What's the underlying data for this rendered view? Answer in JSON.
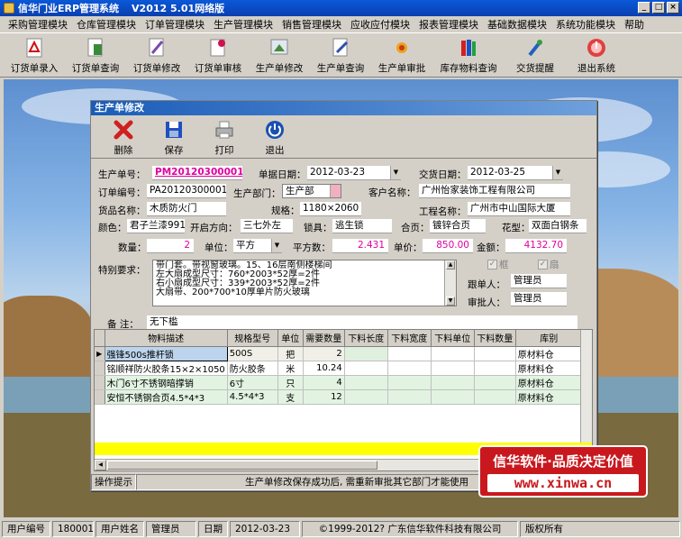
{
  "app": {
    "title": "信华门业ERP管理系统",
    "version": "V2012  5.01网络版"
  },
  "menu": [
    "采购管理模块",
    "仓库管理模块",
    "订单管理模块",
    "生产管理模块",
    "销售管理模块",
    "应收应付模块",
    "报表管理模块",
    "基础数据模块",
    "系统功能模块",
    "帮助"
  ],
  "toolbar": [
    {
      "label": "订货单录入",
      "icon": "pdf-document-icon"
    },
    {
      "label": "订货单查询",
      "icon": "document-search-icon"
    },
    {
      "label": "订货单修改",
      "icon": "document-edit-icon"
    },
    {
      "label": "订货单审核",
      "icon": "document-pin-icon"
    },
    {
      "label": "生产单修改",
      "icon": "image-edit-icon"
    },
    {
      "label": "生产单查询",
      "icon": "document-pencil-icon"
    },
    {
      "label": "生产单审批",
      "icon": "flower-icon"
    },
    {
      "label": "库存物料查询",
      "icon": "books-icon"
    },
    {
      "label": "交货提醒",
      "icon": "pen-icon"
    },
    {
      "label": "退出系统",
      "icon": "exit-icon"
    }
  ],
  "window": {
    "title": "生产单修改",
    "tools": [
      {
        "label": "删除",
        "icon": "delete-x-icon"
      },
      {
        "label": "保存",
        "icon": "save-disk-icon"
      },
      {
        "label": "打印",
        "icon": "printer-icon"
      },
      {
        "label": "退出",
        "icon": "power-icon"
      }
    ]
  },
  "form": {
    "prod_no_label": "生产单号：",
    "prod_no": "PM20120300001",
    "bill_date_label": "单据日期：",
    "bill_date": "2012-03-23",
    "delivery_date_label": "交货日期：",
    "delivery_date": "2012-03-25",
    "order_no_label": "订单编号：",
    "order_no": "PA20120300001",
    "dept_label": "生产部门：",
    "dept": "生产部",
    "customer_label": "客户名称：",
    "customer": "广州怡家装饰工程有限公司",
    "goods_label": "货品名称：",
    "goods": "木质防火门",
    "spec_label": "规格：",
    "spec": "1180×2060",
    "project_label": "工程名称：",
    "project": "广州市中山国际大厦",
    "color_label": "颜色：",
    "color": "君子兰漆9913",
    "open_dir_label": "开启方向：",
    "open_dir": "三七外左",
    "lock_label": "锁具：",
    "lock": "逃生锁",
    "hinge_label": "合页：",
    "hinge": "镀锌合页",
    "pattern_label": "花型：",
    "pattern": "双面白钢条",
    "qty_label": "数量：",
    "qty": "2",
    "unit_label": "单位：",
    "unit": "平方",
    "area_label": "平方数：",
    "area": "2.431",
    "price_label": "单价：",
    "price": "850.00",
    "amount_label": "金额：",
    "amount": "4132.70",
    "special_label": "特别要求：",
    "special_lines": [
      "带门套。带视窗玻璃。15、16层南侧楼梯间",
      "左大扇成型尺寸：760*2003*52厚=2件",
      "右小扇成型尺寸：339*2003*52厚=2件",
      "大扇带、200*700*10厚单片防火玻璃"
    ],
    "chk_frame": "框",
    "chk_leaf": "扇",
    "follower_label": "跟单人：",
    "follower": "管理员",
    "approver_label": "审批人：",
    "approver": "管理员",
    "remark_label": "备  注：",
    "remark": "无下槛"
  },
  "grid": {
    "columns": [
      "物料描述",
      "规格型号",
      "单位",
      "需要数量",
      "下料长度",
      "下料宽度",
      "下料单位",
      "下料数量",
      "库别"
    ],
    "rows": [
      [
        "强锋500s推杆锁",
        "500S",
        "把",
        "2",
        "",
        "",
        "",
        "",
        "原材料仓"
      ],
      [
        "铭顺祥防火胶条15×2×1050",
        "防火胶条",
        "米",
        "10.24",
        "",
        "",
        "",
        "",
        "原材料仓"
      ],
      [
        "木门6寸不锈钢暗撑销",
        "6寸",
        "只",
        "4",
        "",
        "",
        "",
        "",
        "原材料仓"
      ],
      [
        "安恒不锈钢合页4.5*4*3",
        "4.5*4*3",
        "支",
        "12",
        "",
        "",
        "",
        "",
        "原材料仓"
      ]
    ]
  },
  "opbar": {
    "label": "操作提示",
    "message": "生产单修改保存成功后, 需重新审批其它部门才能使用"
  },
  "promo": {
    "line1": "信华软件·品质决定价值",
    "line2": "www.xinwa.cn"
  },
  "status": [
    "用户编号",
    "180001",
    "用户姓名",
    "管理员",
    "日期",
    "2012-03-23",
    "©1999-2012?  广东信华软件科技有限公司",
    "版权所有"
  ],
  "colors": {
    "title_blue": "#0a4fc8",
    "pink_value": "#e000a0",
    "promo_red": "#c8181e",
    "total_row": "#ffff00"
  }
}
